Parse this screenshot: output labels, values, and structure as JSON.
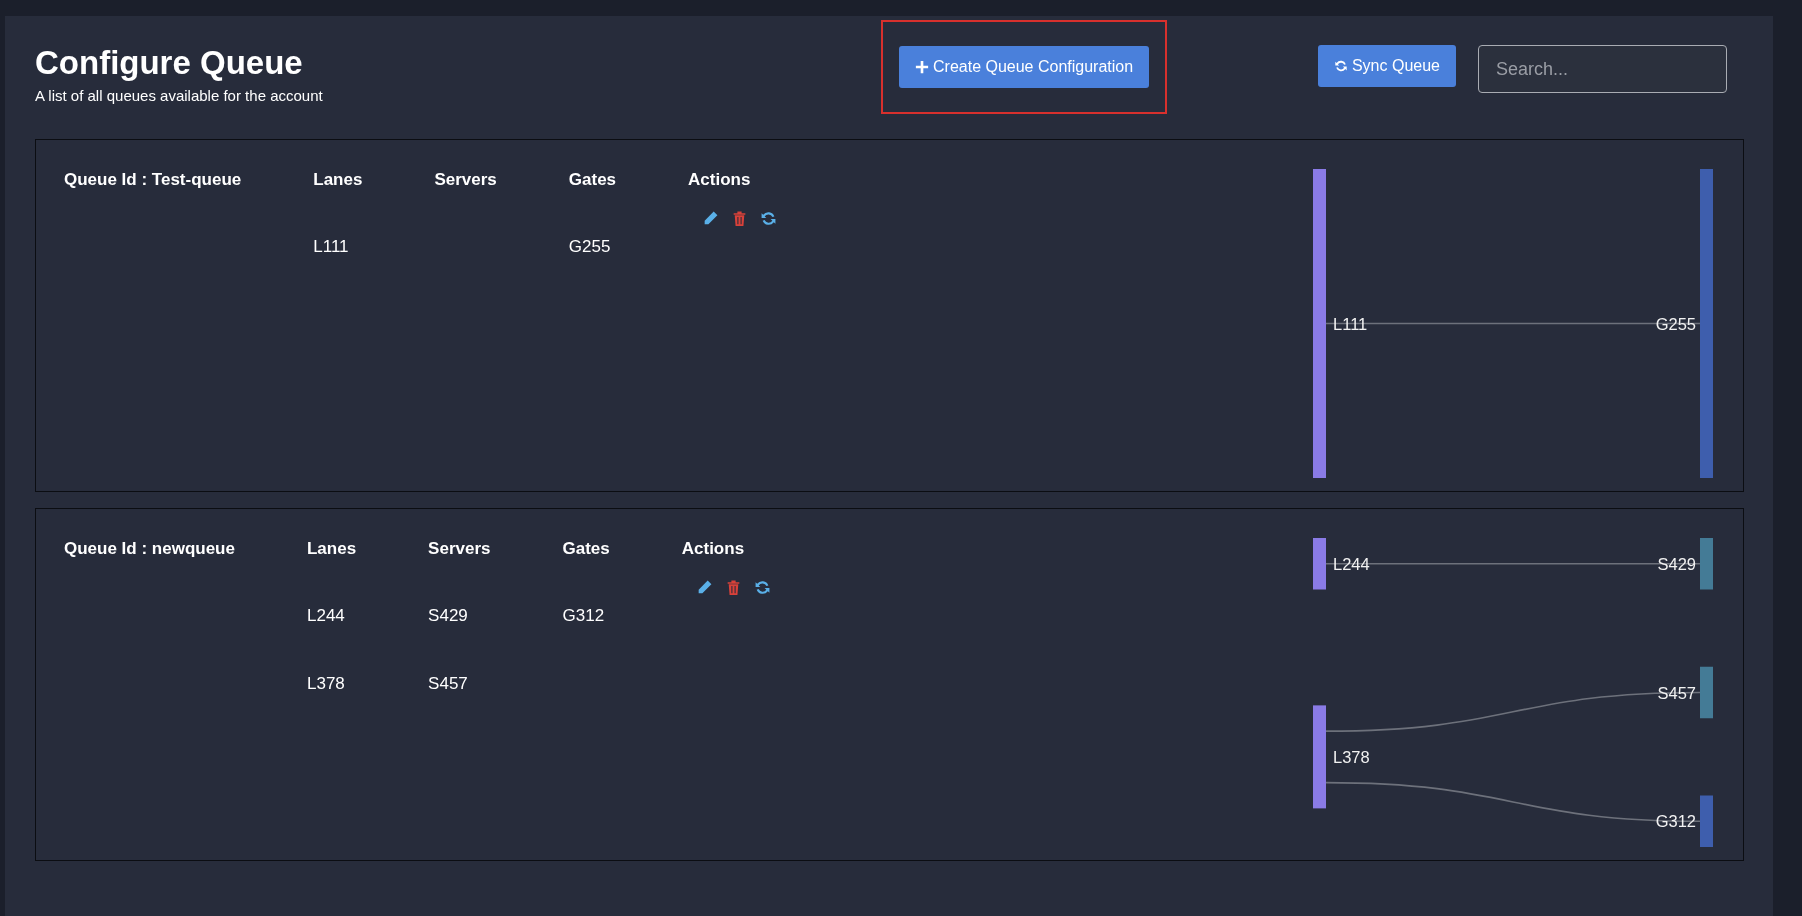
{
  "header": {
    "title": "Configure Queue",
    "subtitle": "A list of all queues available for the account"
  },
  "toolbar": [
    {
      "kind": "create",
      "label": "Create Queue Configuration",
      "highlighted": true
    },
    {
      "kind": "sync",
      "label": "Sync Queue",
      "highlighted": false
    }
  ],
  "search": {
    "placeholder": "Search..."
  },
  "queues": [
    {
      "queue_id": "Queue Id : Test-queue",
      "columns": [
        "Lanes",
        "Servers",
        "Gates",
        "Actions"
      ],
      "rows": [
        {
          "lane": "L111",
          "gate": "G255"
        }
      ],
      "flow_diagram": {
        "lanes": [
          {
            "label": "L111",
            "color": "#8a7be6",
            "outputs": [
              {
                "label": "G255",
                "color": "#3e5ead"
              }
            ]
          }
        ]
      }
    },
    {
      "queue_id": "Queue Id : newqueue",
      "columns": [
        "Lanes",
        "Servers",
        "Gates",
        "Actions"
      ],
      "rows": [
        {
          "lane": "L244",
          "server": "S429",
          "gate": "G312"
        },
        {
          "lane": "L378",
          "server": "S457"
        }
      ],
      "flow_diagram": {
        "lanes": [
          {
            "label": "L244",
            "color": "#8a7be6",
            "outputs": [
              {
                "label": "S429",
                "color": "#447b96"
              }
            ]
          },
          {
            "label": "L378",
            "color": "#8a7be6",
            "outputs": [
              {
                "label": "S457",
                "color": "#447b96"
              },
              {
                "label": "G312",
                "color": "#3e5ead"
              }
            ]
          }
        ]
      }
    }
  ]
}
